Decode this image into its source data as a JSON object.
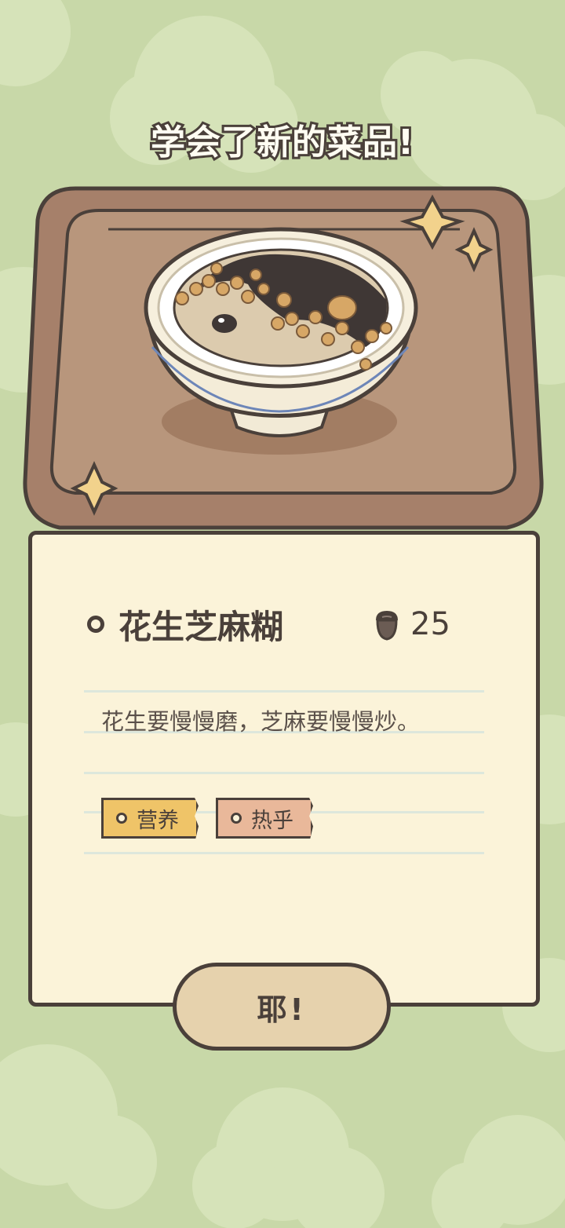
{
  "header": {
    "title": "学会了新的菜品!"
  },
  "dish": {
    "name": "花生芝麻糊",
    "price": "25",
    "price_icon": "acorn-icon",
    "description": "花生要慢慢磨，芝麻要慢慢炒。",
    "tags": [
      {
        "label": "营养",
        "color": "#efc468"
      },
      {
        "label": "热乎",
        "color": "#e9b89a"
      }
    ]
  },
  "actions": {
    "confirm_label": "耶!"
  },
  "colors": {
    "background": "#c8d8a8",
    "card": "#fbf3d9",
    "tray": "#a6806a",
    "outline": "#4a403a",
    "button": "#e6d2ad"
  }
}
